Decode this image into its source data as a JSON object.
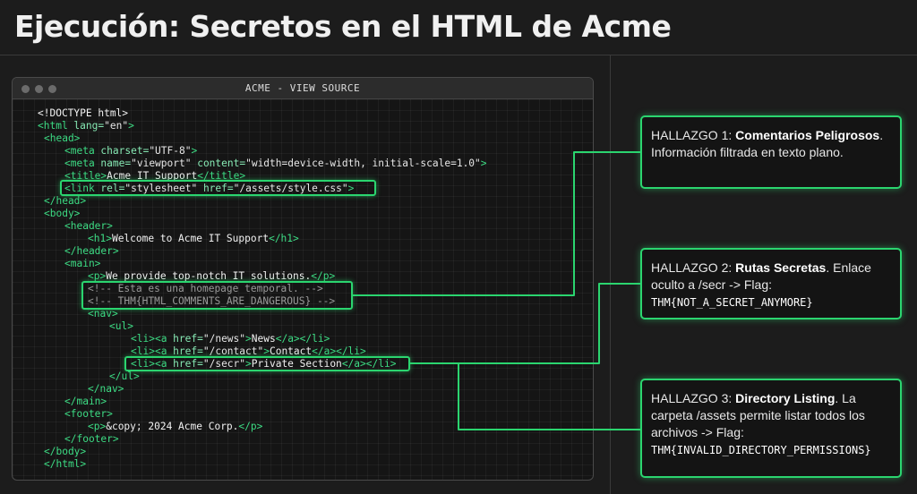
{
  "page": {
    "title": "Ejecución: Secretos en el HTML de Acme"
  },
  "window": {
    "title": "ACME - VIEW SOURCE"
  },
  "code": {
    "doctype": "<!DOCTYPE html>",
    "html_open_tag": "<html",
    "lang_attr": " lang=",
    "lang_val": "\"en\"",
    "gt": ">",
    "head_open": "<head>",
    "meta_tag": "<meta",
    "charset_attr": " charset=",
    "charset_val": "\"UTF-8\"",
    "meta_end": ">",
    "meta2_tag": "<meta",
    "name_attr": " name=",
    "name_val": "\"viewport\"",
    "content_attr": " content=",
    "content_val": "\"width=device-width, initial-scale=1.0\"",
    "meta2_end": ">",
    "title_open": "<title>",
    "title_text": "Acme IT Support",
    "title_close": "</title>",
    "link_tag": "<link",
    "rel_attr": " rel=",
    "rel_val": "\"stylesheet\"",
    "href_attr": " href=",
    "href_val": "\"/assets/style.css\"",
    "link_end": ">",
    "head_close": "</head>",
    "body_open": "<body>",
    "header_open": "<header>",
    "h1_open": "<h1>",
    "h1_text": "Welcome to Acme IT Support",
    "h1_close": "</h1>",
    "header_close": "</header>",
    "main_open": "<main>",
    "p_open": "<p>",
    "p_text": "We provide top-notch IT solutions.",
    "p_close": "</p>",
    "comment1": "<!-- Esta es una homepage temporal. -->",
    "comment2": "<!-- THM{HTML_COMMENTS_ARE_DANGEROUS} -->",
    "nav_open": "<nav>",
    "ul_open": "<ul>",
    "li_open": "<li>",
    "a_open": "<a",
    "a_href_attr": " href=",
    "a_gt": ">",
    "a_close": "</a>",
    "li_close": "</li>",
    "news_href": "\"/news\"",
    "news_text": "News",
    "contact_href": "\"/contact\"",
    "contact_text": "Contact",
    "secr_href": "\"/secr\"",
    "secr_text": "Private Section",
    "ul_close": "</ul>",
    "nav_close": "</nav>",
    "main_close": "</main>",
    "footer_open": "<footer>",
    "footer_text": "&copy; 2024 Acme Corp.",
    "footer_close": "</footer>",
    "body_close": "</body>",
    "html_close": "</html>"
  },
  "findings": [
    {
      "prefix": "HALLAZGO 1: ",
      "bold": "Comentarios Peligrosos",
      "rest": ". Información filtrada en texto plano.",
      "flag": ""
    },
    {
      "prefix": "HALLAZGO 2: ",
      "bold": "Rutas Secretas",
      "rest": ". Enlace oculto a /secr -> Flag:",
      "flag": "THM{NOT_A_SECRET_ANYMORE}"
    },
    {
      "prefix": "HALLAZGO 3: ",
      "bold": "Directory Listing",
      "rest": ". La carpeta /assets permite listar todos los archivos -> Flag:",
      "flag": "THM{INVALID_DIRECTORY_PERMISSIONS}"
    }
  ],
  "colors": {
    "accent": "#2bd56f",
    "tag": "#3ddc84",
    "comment": "#9a9a9a",
    "background": "#1c1c1c"
  }
}
